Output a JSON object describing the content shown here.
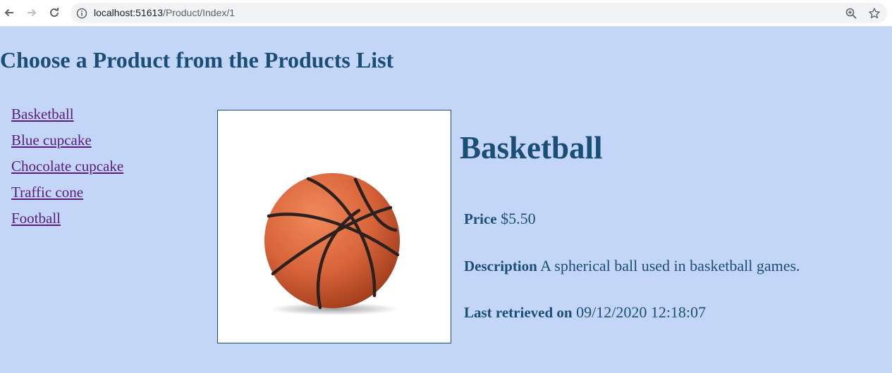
{
  "browser": {
    "url_host": "localhost:51613",
    "url_path": "/Product/Index/1"
  },
  "page": {
    "title": "Choose a Product from the Products List"
  },
  "products": [
    {
      "label": "Basketball"
    },
    {
      "label": "Blue cupcake"
    },
    {
      "label": "Chocolate cupcake"
    },
    {
      "label": "Traffic cone"
    },
    {
      "label": "Football"
    }
  ],
  "detail": {
    "name": "Basketball",
    "price_label": "Price",
    "price_value": "$5.50",
    "description_label": "Description",
    "description_value": "A spherical ball used in basketball games.",
    "retrieved_label": "Last retrieved on",
    "retrieved_value": "09/12/2020 12:18:07"
  },
  "colors": {
    "background": "#c4d6f7",
    "heading": "#1b4e77",
    "link": "#5b1a80",
    "ball": "#d9643a"
  }
}
